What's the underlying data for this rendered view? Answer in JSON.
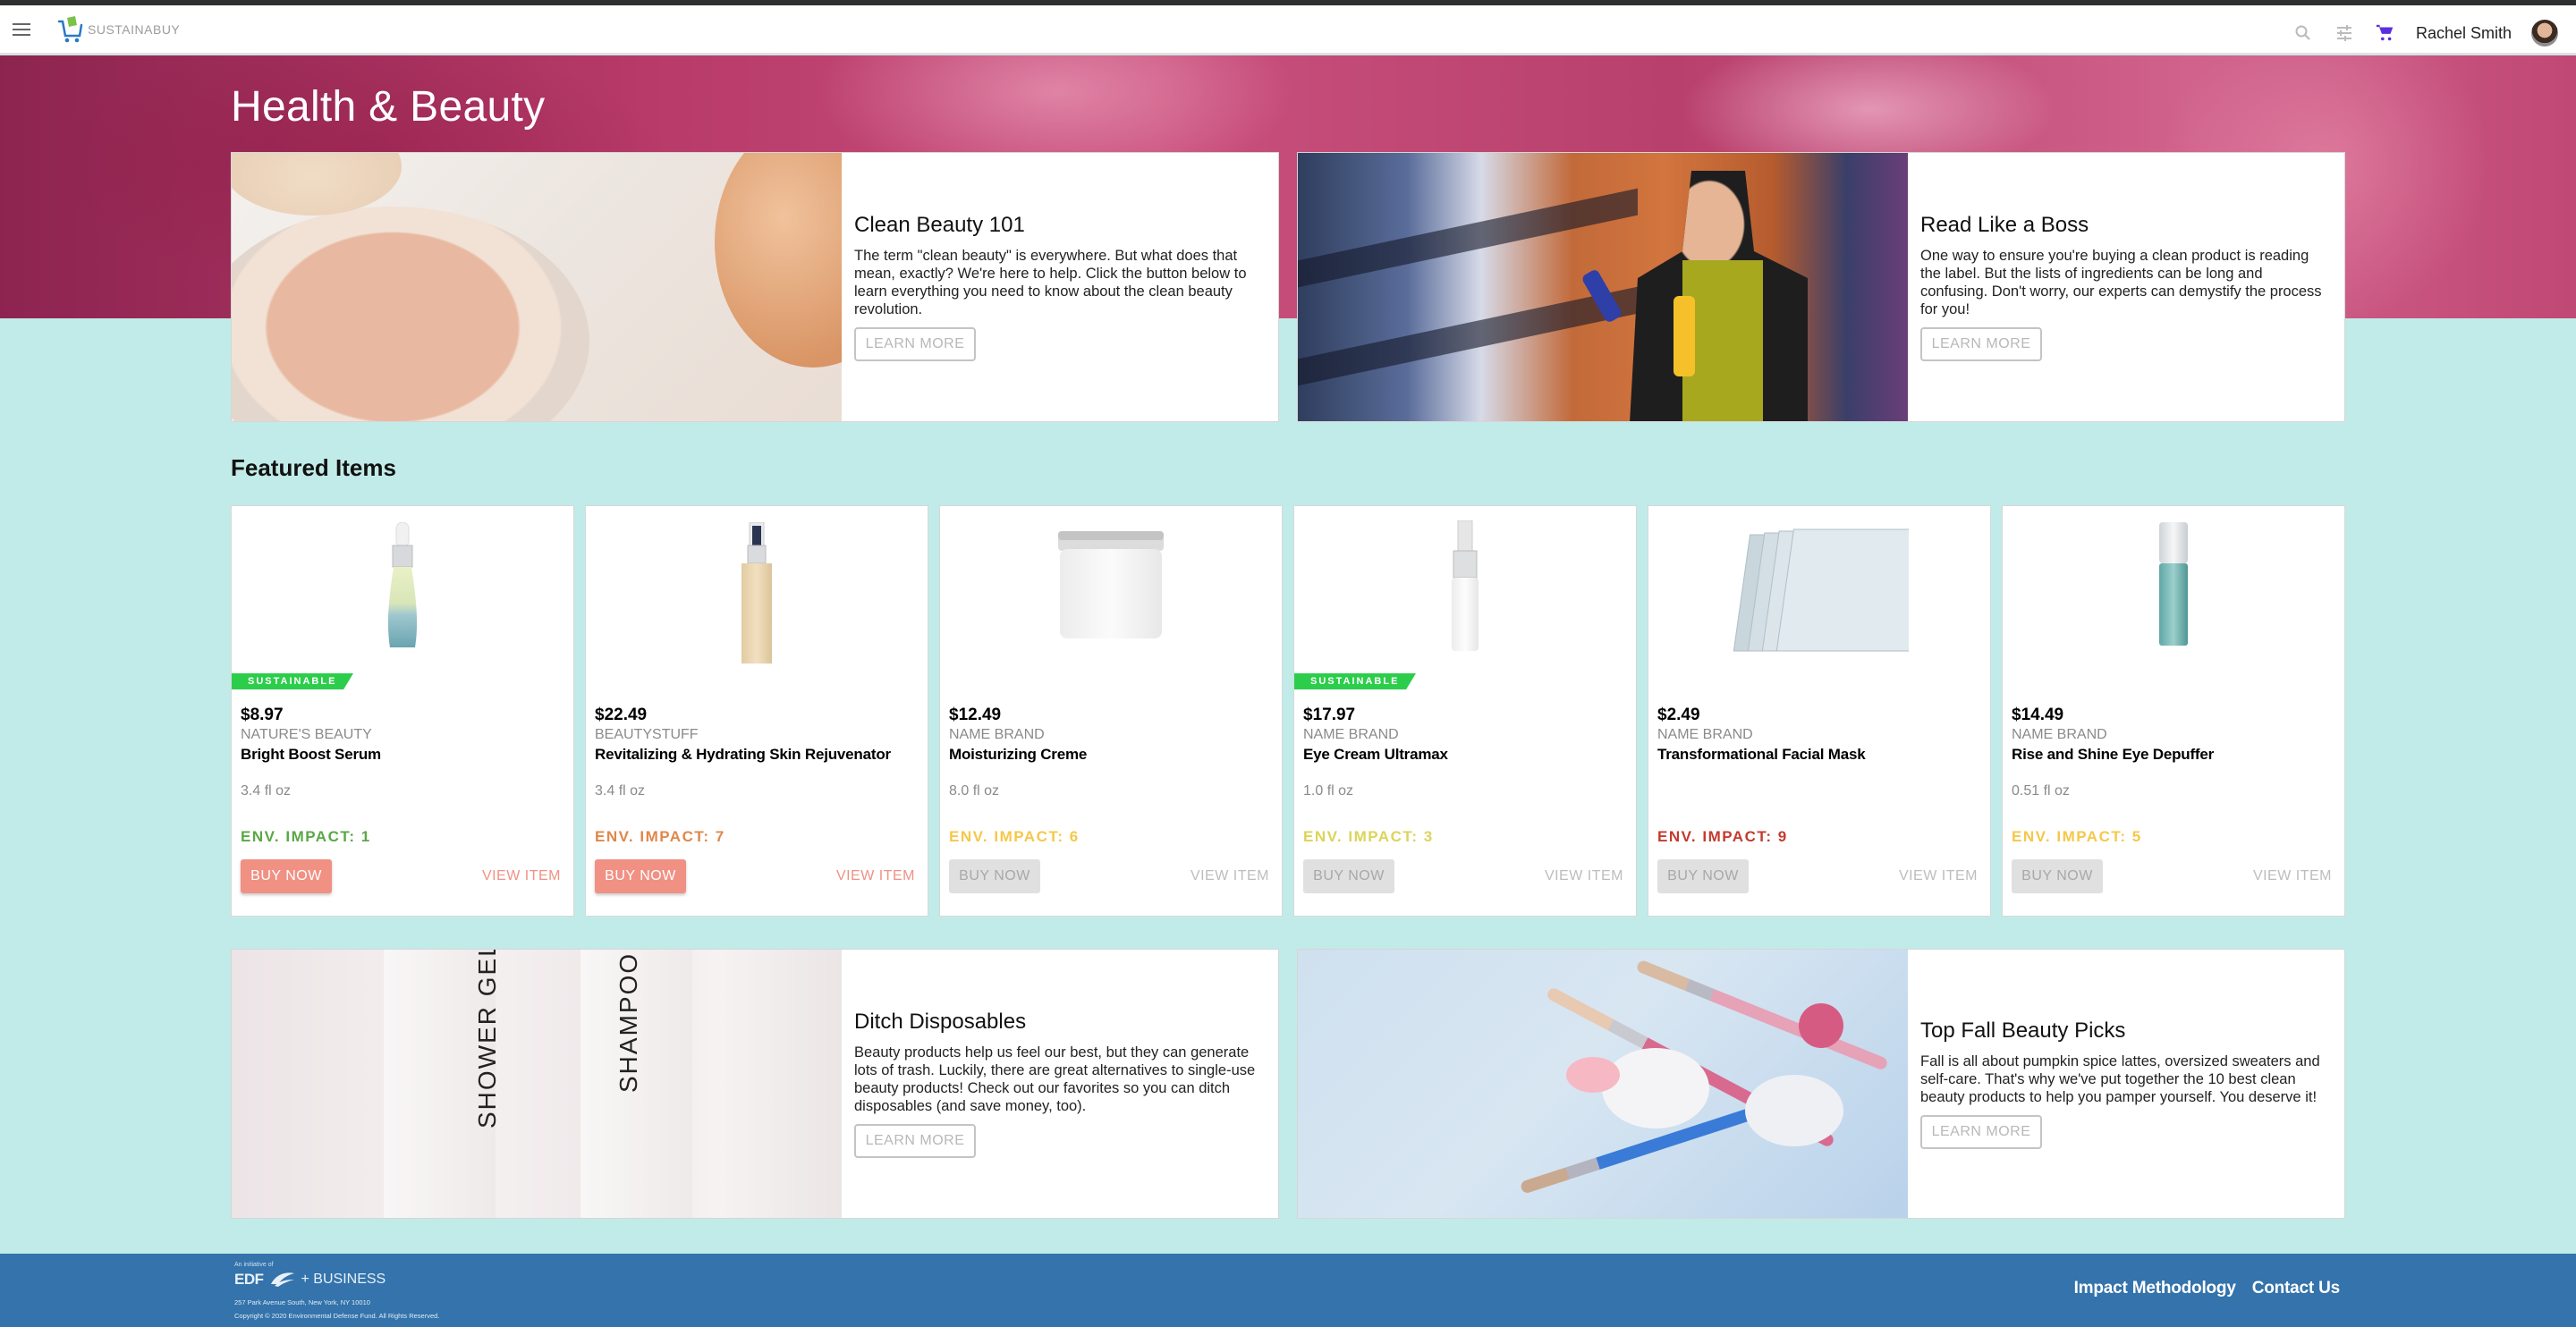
{
  "app": {
    "brand": "SUSTAINABUY",
    "user_name": "Rachel Smith",
    "icons": {
      "menu": "hamburger-menu-icon",
      "search": "search-icon",
      "filter": "tune-sliders-icon",
      "cart": "shopping-cart-icon"
    },
    "colors": {
      "cart_accent": "#5b2ee0",
      "page_bg": "#c1ebe8",
      "footer_bg": "#3473ab",
      "sustainable_badge": "#2ccd4b",
      "buy_now_active": "#f09184"
    }
  },
  "hero": {
    "title": "Health & Beauty"
  },
  "promos": [
    {
      "title": "Clean Beauty 101",
      "text": "The term \"clean beauty\" is everywhere. But what does that mean, exactly? We're here to help. Click the button below to learn everything you need to know about the clean beauty revolution.",
      "button": "LEARN MORE"
    },
    {
      "title": "Read Like a Boss",
      "text": "One way to ensure you're buying a clean product is reading the label. But the lists of ingredients can be long and confusing. Don't worry, our experts can demystify the process for you!",
      "button": "LEARN MORE"
    },
    {
      "title": "Ditch Disposables",
      "text": "Beauty products help us feel our best, but they can generate lots of trash. Luckily, there are great alternatives to single-use beauty products! Check out our favorites so you can ditch disposables (and save money, too).",
      "button": "LEARN MORE",
      "image_labels": [
        "SHOWER GEL",
        "SHAMPOO"
      ]
    },
    {
      "title": "Top Fall Beauty Picks",
      "text": "Fall is all about pumpkin spice lattes, oversized sweaters and self-care. That's why we've put together the 10 best clean beauty products to help you pamper yourself. You deserve it!",
      "button": "LEARN MORE"
    }
  ],
  "featured": {
    "title": "Featured Items",
    "buy_label": "BUY NOW",
    "view_label": "VIEW ITEM",
    "badge_label": "SUSTAINABLE",
    "products": [
      {
        "price": "$8.97",
        "brand": "NATURE'S BEAUTY",
        "name": "Bright Boost Serum",
        "size": "3.4 fl oz",
        "impact": "ENV. IMPACT: 1",
        "impact_color": "#5aa845",
        "sustainable": true,
        "buy_enabled": true
      },
      {
        "price": "$22.49",
        "brand": "BEAUTYSTUFF",
        "name": "Revitalizing & Hydrating Skin Rejuvenator",
        "size": "3.4 fl oz",
        "impact": "ENV. IMPACT: 7",
        "impact_color": "#e0874a",
        "sustainable": false,
        "buy_enabled": true
      },
      {
        "price": "$12.49",
        "brand": "NAME BRAND",
        "name": "Moisturizing Creme",
        "size": "8.0 fl oz",
        "impact": "ENV. IMPACT: 6",
        "impact_color": "#f5c84a",
        "sustainable": false,
        "buy_enabled": false
      },
      {
        "price": "$17.97",
        "brand": "NAME BRAND",
        "name": "Eye Cream Ultramax",
        "size": "1.0 fl oz",
        "impact": "ENV. IMPACT: 3",
        "impact_color": "#ddd35a",
        "sustainable": true,
        "buy_enabled": false
      },
      {
        "price": "$2.49",
        "brand": "NAME BRAND",
        "name": "Transformational Facial Mask",
        "size": "",
        "impact": "ENV. IMPACT: 9",
        "impact_color": "#c43a2e",
        "sustainable": false,
        "buy_enabled": false
      },
      {
        "price": "$14.49",
        "brand": "NAME BRAND",
        "name": "Rise and Shine Eye Depuffer",
        "size": "0.51 fl oz",
        "impact": "ENV. IMPACT: 5",
        "impact_color": "#f5c84a",
        "sustainable": false,
        "buy_enabled": false
      }
    ]
  },
  "footer": {
    "initiative": "An initiative of",
    "org_short": "EDF",
    "org_plus": "+ BUSINESS",
    "address": "257 Park Avenue South, New York, NY 10010",
    "copyright": "Copyright © 2020 Environmental Defense Fund. All Rights Reserved.",
    "links": [
      "Impact Methodology",
      "Contact Us"
    ]
  }
}
